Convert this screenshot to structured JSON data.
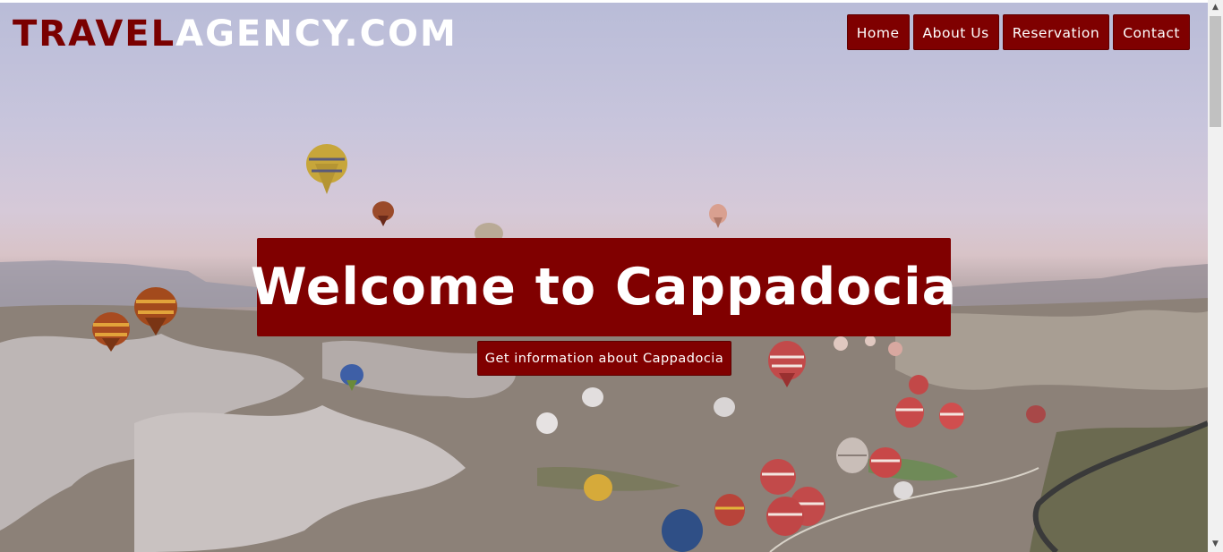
{
  "logo": {
    "part1": "TRAVEL",
    "part2": "AGENCY.COM"
  },
  "nav": {
    "items": [
      "Home",
      "About Us",
      "Reservation",
      "Contact"
    ]
  },
  "hero": {
    "title": "Welcome to Cappadocia",
    "cta_label": "Get information about Cappadocia"
  },
  "colors": {
    "accent": "#800000",
    "logo_dark": "#7a0000",
    "text": "#ffffff"
  },
  "icons": {
    "scroll_up": "scroll-up-arrow-icon",
    "scroll_down": "scroll-down-arrow-icon"
  }
}
